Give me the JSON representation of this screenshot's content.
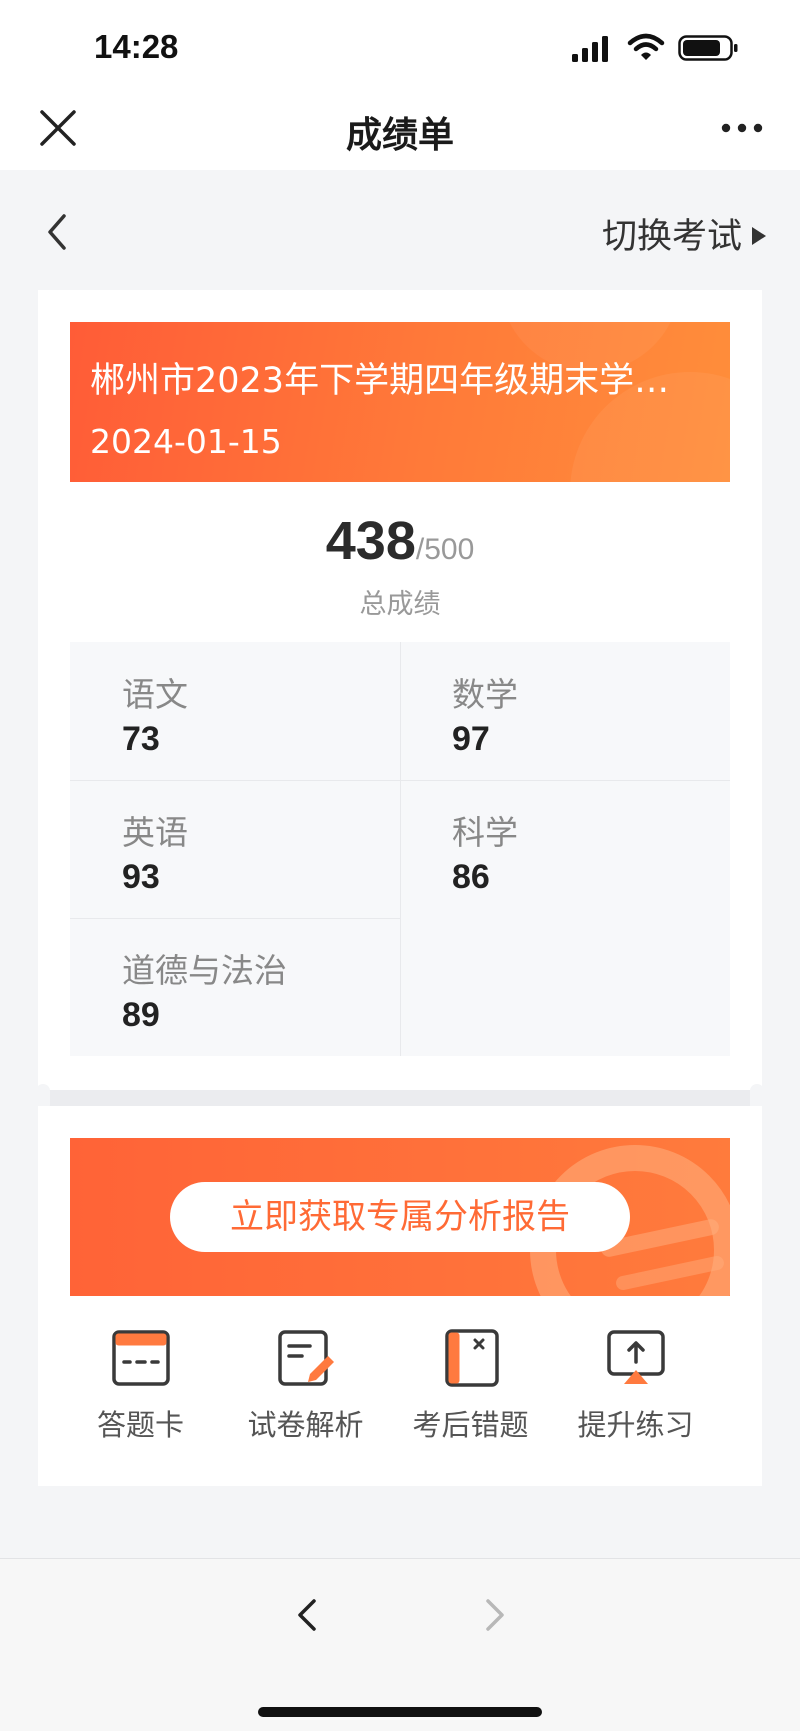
{
  "status_bar": {
    "time": "14:28",
    "icons": [
      "signal-icon",
      "wifi-icon",
      "battery-icon"
    ]
  },
  "navbar": {
    "title": "成绩单",
    "close_icon": "close-icon",
    "more_icon": "more-icon"
  },
  "sub_header": {
    "back_icon": "chevron-left-icon",
    "switch_label": "切换考试"
  },
  "exam": {
    "title": "郴州市2023年下学期四年级期末学…",
    "date": "2024-01-15",
    "score": "438",
    "total": "/500",
    "score_label": "总成绩"
  },
  "subjects": [
    {
      "name": "语文",
      "score": "73"
    },
    {
      "name": "数学",
      "score": "97"
    },
    {
      "name": "英语",
      "score": "93"
    },
    {
      "name": "科学",
      "score": "86"
    },
    {
      "name": "道德与法治",
      "score": "89"
    }
  ],
  "promo": {
    "button_label": "立即获取专属分析报告"
  },
  "tools": [
    {
      "label": "答题卡",
      "icon": "answer-sheet-icon"
    },
    {
      "label": "试卷解析",
      "icon": "paper-analysis-icon"
    },
    {
      "label": "考后错题",
      "icon": "wrong-questions-icon"
    },
    {
      "label": "提升练习",
      "icon": "practice-icon"
    }
  ],
  "bottom_bar": {
    "back_icon": "chevron-left-icon",
    "forward_icon": "chevron-right-icon"
  },
  "colors": {
    "accent": "#ff6a35",
    "banner_start": "#ff5c37",
    "banner_end": "#ff8e3a",
    "page_bg": "#f4f5f7"
  }
}
